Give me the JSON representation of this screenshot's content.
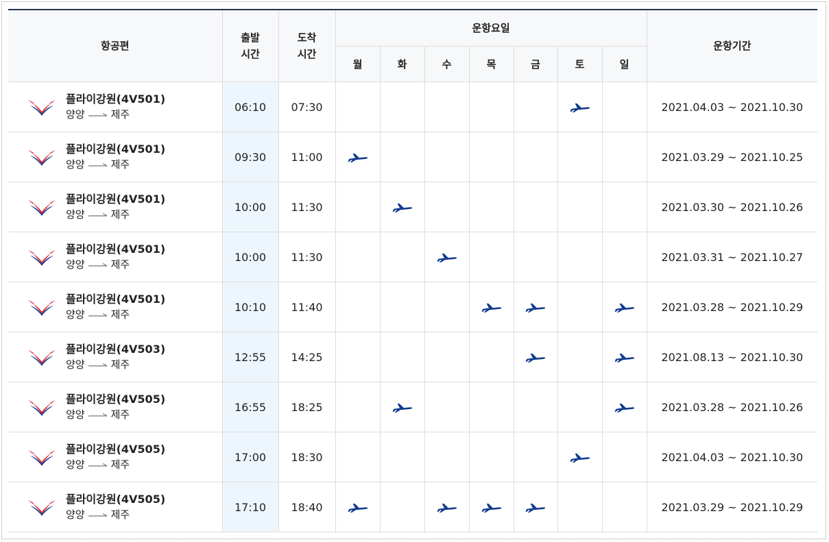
{
  "headers": {
    "flight": "항공편",
    "departure_line1": "출발",
    "departure_line2": "시간",
    "arrival_line1": "도착",
    "arrival_line2": "시간",
    "days_group": "운항요일",
    "days": [
      "월",
      "화",
      "수",
      "목",
      "금",
      "토",
      "일"
    ],
    "period": "운항기간"
  },
  "colors": {
    "plane": "#0f3a8c",
    "logo_red": "#d7262f",
    "logo_blue": "#1d3f8f",
    "departure_highlight": "#eef6fd",
    "header_border": "#1f2f4a"
  },
  "icons": {
    "flight_logo": "fly-gangwon-logo-icon",
    "operating_day": "airplane-icon"
  },
  "rows": [
    {
      "flight": "플라이강원(4V501)",
      "from": "양양",
      "to": "제주",
      "dep": "06:10",
      "arr": "07:30",
      "days": [
        0,
        0,
        0,
        0,
        0,
        1,
        0
      ],
      "period": "2021.04.03 ~ 2021.10.30"
    },
    {
      "flight": "플라이강원(4V501)",
      "from": "양양",
      "to": "제주",
      "dep": "09:30",
      "arr": "11:00",
      "days": [
        1,
        0,
        0,
        0,
        0,
        0,
        0
      ],
      "period": "2021.03.29 ~ 2021.10.25"
    },
    {
      "flight": "플라이강원(4V501)",
      "from": "양양",
      "to": "제주",
      "dep": "10:00",
      "arr": "11:30",
      "days": [
        0,
        1,
        0,
        0,
        0,
        0,
        0
      ],
      "period": "2021.03.30 ~ 2021.10.26"
    },
    {
      "flight": "플라이강원(4V501)",
      "from": "양양",
      "to": "제주",
      "dep": "10:00",
      "arr": "11:30",
      "days": [
        0,
        0,
        1,
        0,
        0,
        0,
        0
      ],
      "period": "2021.03.31 ~ 2021.10.27"
    },
    {
      "flight": "플라이강원(4V501)",
      "from": "양양",
      "to": "제주",
      "dep": "10:10",
      "arr": "11:40",
      "days": [
        0,
        0,
        0,
        1,
        1,
        0,
        1
      ],
      "period": "2021.03.28 ~ 2021.10.29"
    },
    {
      "flight": "플라이강원(4V503)",
      "from": "양양",
      "to": "제주",
      "dep": "12:55",
      "arr": "14:25",
      "days": [
        0,
        0,
        0,
        0,
        1,
        0,
        1
      ],
      "period": "2021.08.13 ~ 2021.10.30"
    },
    {
      "flight": "플라이강원(4V505)",
      "from": "양양",
      "to": "제주",
      "dep": "16:55",
      "arr": "18:25",
      "days": [
        0,
        1,
        0,
        0,
        0,
        0,
        1
      ],
      "period": "2021.03.28 ~ 2021.10.26"
    },
    {
      "flight": "플라이강원(4V505)",
      "from": "양양",
      "to": "제주",
      "dep": "17:00",
      "arr": "18:30",
      "days": [
        0,
        0,
        0,
        0,
        0,
        1,
        0
      ],
      "period": "2021.04.03 ~ 2021.10.30"
    },
    {
      "flight": "플라이강원(4V505)",
      "from": "양양",
      "to": "제주",
      "dep": "17:10",
      "arr": "18:40",
      "days": [
        1,
        0,
        1,
        1,
        1,
        0,
        0
      ],
      "period": "2021.03.29 ~ 2021.10.29"
    }
  ]
}
